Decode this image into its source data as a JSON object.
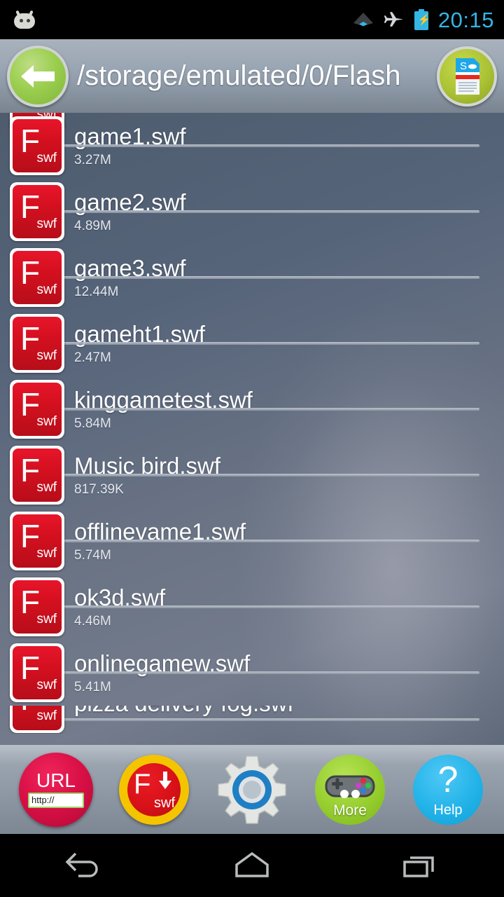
{
  "statusbar": {
    "clock": "20:15",
    "icons": [
      "notification-robot-icon",
      "wifi-icon",
      "airplane-mode-icon",
      "battery-charging-icon"
    ]
  },
  "header": {
    "back_label": "back-arrow",
    "path": "/storage/emulated/0/Flash",
    "sd_label": "sd-card"
  },
  "files": [
    {
      "name": "game1.swf",
      "size": "3.27M"
    },
    {
      "name": "game2.swf",
      "size": "4.89M"
    },
    {
      "name": "game3.swf",
      "size": "12.44M"
    },
    {
      "name": "gameht1.swf",
      "size": "2.47M"
    },
    {
      "name": "kinggametest.swf",
      "size": "5.84M"
    },
    {
      "name": "Music bird.swf",
      "size": "817.39K"
    },
    {
      "name": "offlinevame1.swf",
      "size": "5.74M"
    },
    {
      "name": "ok3d.swf",
      "size": "4.46M"
    },
    {
      "name": "onlinegamew.swf",
      "size": "5.41M"
    },
    {
      "name": "pizza delivery fog.swf",
      "size": ""
    }
  ],
  "file_icon": {
    "letter": "F",
    "ext": "swf"
  },
  "toolbar": {
    "url_label": "URL",
    "url_field_value": "http://",
    "swf_letter": "F",
    "swf_ext": "swf",
    "settings_label": "settings-gear",
    "more_label": "More",
    "help_mark": "?",
    "help_label": "Help"
  },
  "navbar": {
    "back": "back-nav",
    "home": "home-nav",
    "recents": "recents-nav"
  },
  "colors": {
    "accent_red": "#d81118",
    "accent_green": "#9ccf50",
    "accent_blue": "#23b3e8",
    "accent_yellow": "#f5c400",
    "clock_blue": "#33b5e5",
    "url_crimson": "#d70f45"
  }
}
